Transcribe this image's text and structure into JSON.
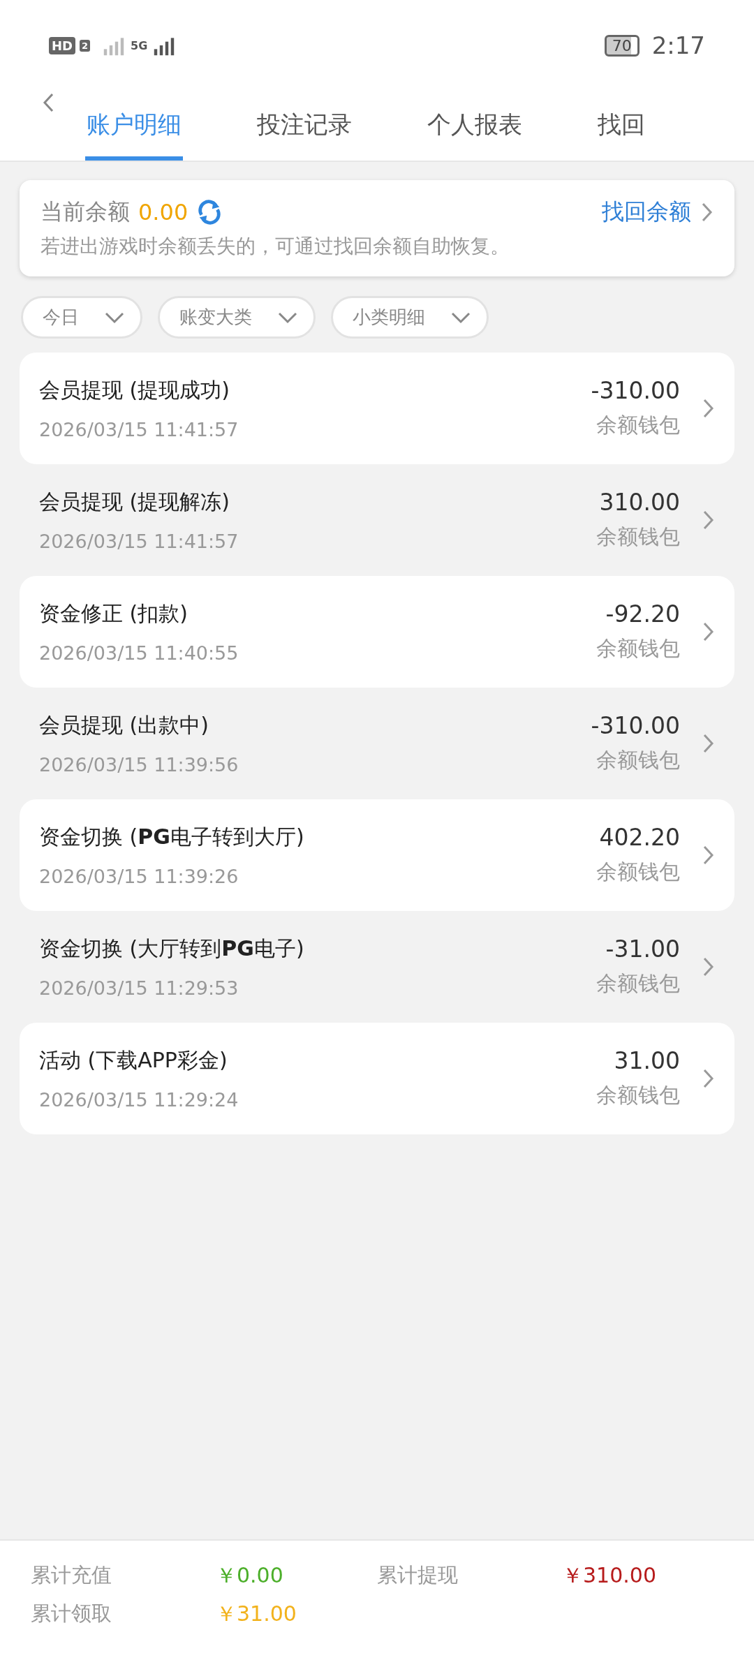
{
  "status_bar": {
    "hd": "HD",
    "hd_sub": "2",
    "network": "5G",
    "battery": "70",
    "time": "2:17"
  },
  "tabs": [
    {
      "label": "账户明细",
      "selected": true
    },
    {
      "label": "投注记录",
      "selected": false
    },
    {
      "label": "个人报表",
      "selected": false
    },
    {
      "label": "找回",
      "selected": false
    }
  ],
  "balance_card": {
    "label": "当前余额",
    "amount": "0.00",
    "link": "找回余额",
    "hint": "若进出游戏时余额丢失的，可通过找回余额自助恢复。"
  },
  "filters": [
    "今日",
    "账变大类",
    "小类明细"
  ],
  "records": [
    {
      "title": "会员提现 (提现成功)",
      "time": "2026/03/15 11:41:57",
      "amount": "-310.00",
      "wallet": "余额钱包",
      "shaded": true
    },
    {
      "title": "会员提现 (提现解冻)",
      "time": "2026/03/15 11:41:57",
      "amount": "310.00",
      "wallet": "余额钱包",
      "shaded": false
    },
    {
      "title": "资金修正 (扣款)",
      "time": "2026/03/15 11:40:55",
      "amount": "-92.20",
      "wallet": "余额钱包",
      "shaded": true
    },
    {
      "title": "会员提现 (出款中)",
      "time": "2026/03/15 11:39:56",
      "amount": "-310.00",
      "wallet": "余额钱包",
      "shaded": false
    },
    {
      "title": "资金切换 (**PG**电子转到大厅)",
      "time": "2026/03/15 11:39:26",
      "amount": "402.20",
      "wallet": "余额钱包",
      "shaded": true
    },
    {
      "title": "资金切换 (大厅转到**PG**电子)",
      "time": "2026/03/15 11:29:53",
      "amount": "-31.00",
      "wallet": "余额钱包",
      "shaded": false
    },
    {
      "title": "活动 (下载APP彩金)",
      "time": "2026/03/15 11:29:24",
      "amount": "31.00",
      "wallet": "余额钱包",
      "shaded": true
    }
  ],
  "totals": [
    {
      "label": "累计充值",
      "value": "￥0.00",
      "color": "#4caf2a"
    },
    {
      "label": "累计提现",
      "value": "￥310.00",
      "color": "#b71c1c"
    },
    {
      "label": "累计领取",
      "value": "￥31.00",
      "color": "#f2b21c"
    }
  ]
}
